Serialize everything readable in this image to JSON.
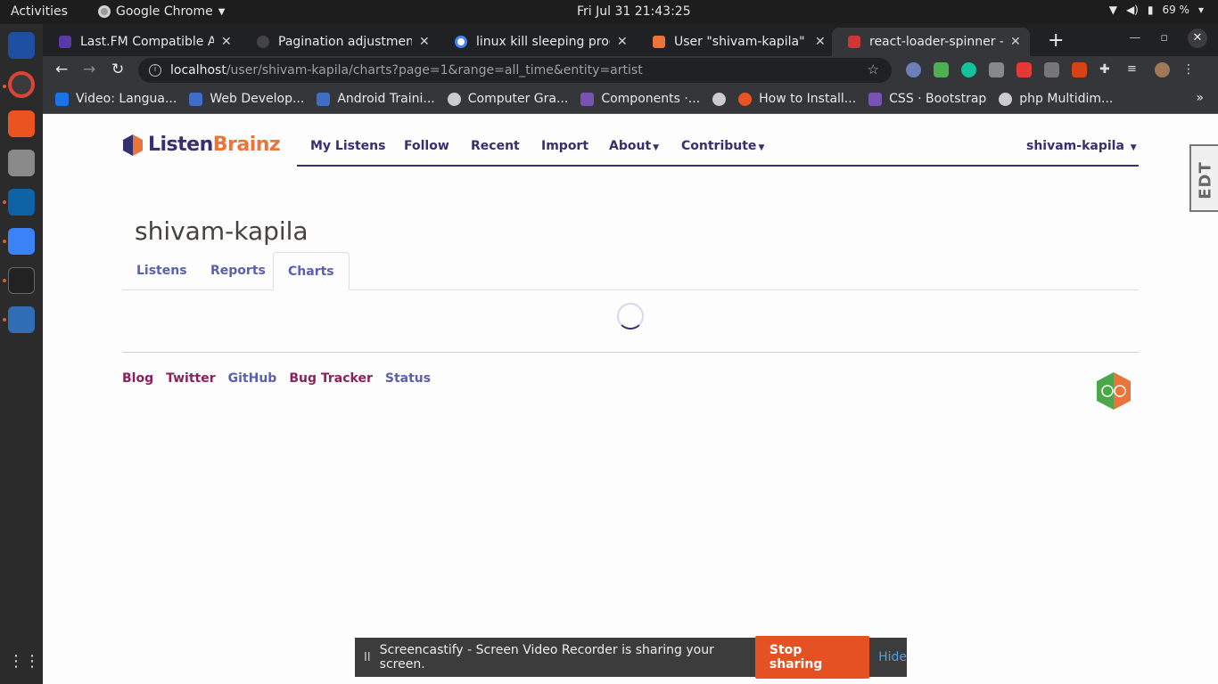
{
  "system_bar": {
    "activities": "Activities",
    "app_name": "Google Chrome",
    "clock": "Fri Jul 31  21:43:25",
    "battery": "69 %"
  },
  "browser": {
    "tabs": [
      {
        "title": "Last.FM Compatible AP",
        "color": "#5a3aa6"
      },
      {
        "title": "Pagination adjustment",
        "color": "#444444"
      },
      {
        "title": "linux kill sleeping proce",
        "color": "#4285f4"
      },
      {
        "title": "User \"shivam-kapila\" - L",
        "color": "#eb743b"
      },
      {
        "title": "react-loader-spinner - n",
        "color": "#cb3837"
      }
    ],
    "active_tab_index": 4,
    "url_host": "localhost",
    "url_path": "/user/shivam-kapila/charts?page=1&range=all_time&entity=artist",
    "bookmarks": [
      {
        "label": "Video: Langua...",
        "color": "#1a73e8"
      },
      {
        "label": "Web Develop...",
        "color": "#3f6ec6"
      },
      {
        "label": "Android Traini...",
        "color": "#3f6ec6"
      },
      {
        "label": "Computer Gra...",
        "color": "#cccccc"
      },
      {
        "label": "Components ·...",
        "color": "#7952b3"
      },
      {
        "label": "",
        "color": "#cccccc"
      },
      {
        "label": "How to Install...",
        "color": "#e95420"
      },
      {
        "label": "CSS · Bootstrap",
        "color": "#7952b3"
      },
      {
        "label": "php Multidim...",
        "color": "#cccccc"
      }
    ],
    "bookmarks_more": "»"
  },
  "site": {
    "logo_listen": "Listen",
    "logo_brainz": "Brainz",
    "nav": [
      "My Listens",
      "Follow",
      "Recent",
      "Import",
      "About",
      "Contribute"
    ],
    "user_menu": "shivam-kapila",
    "username": "shivam-kapila",
    "tabs": [
      "Listens",
      "Reports",
      "Charts"
    ],
    "active_tab": "Charts",
    "footer_links": [
      "Blog",
      "Twitter",
      "GitHub",
      "Bug Tracker",
      "Status"
    ],
    "edt_badge": "EDT"
  },
  "screencastify": {
    "pause": "II",
    "message": "Screencastify - Screen Video Recorder is sharing your screen.",
    "stop": "Stop sharing",
    "hide": "Hide"
  },
  "colors": {
    "brand_purple": "#353070",
    "brand_orange": "#eb743b",
    "footer_magenta": "#8e1f5e",
    "tab_blue": "#5b5fb0",
    "stop_button": "#e65124"
  }
}
